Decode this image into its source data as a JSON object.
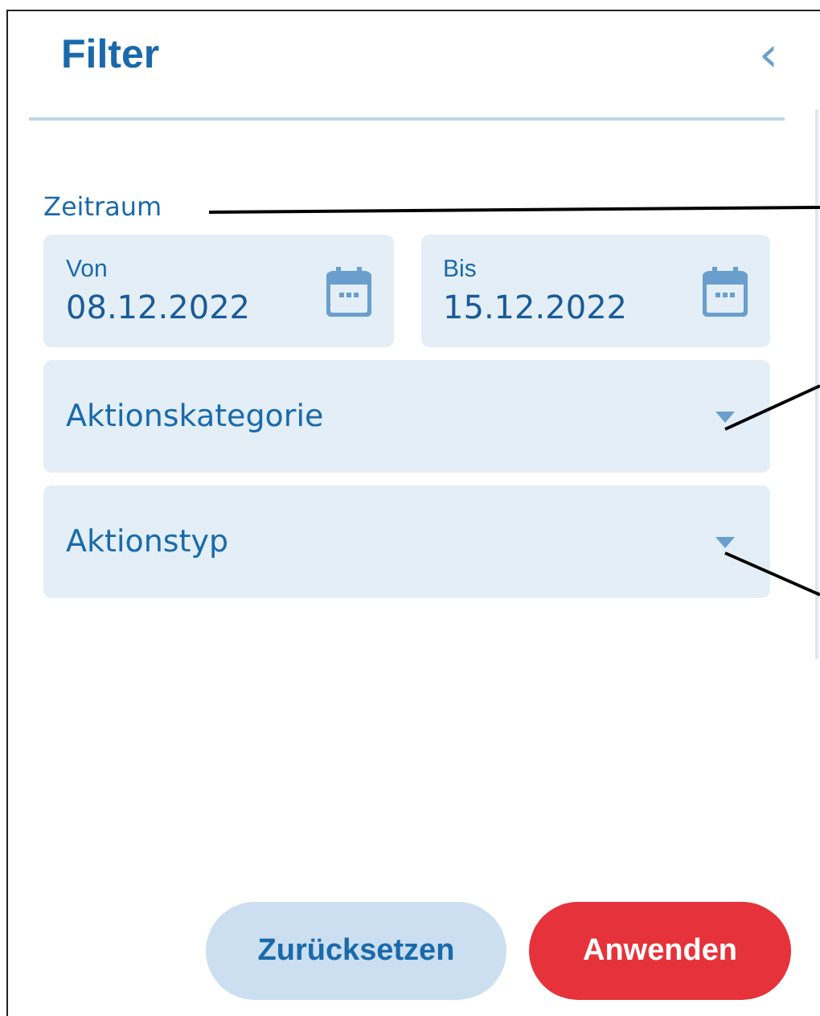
{
  "header": {
    "title": "Filter",
    "back_glyph": "‹"
  },
  "period": {
    "label": "Zeitraum",
    "fields": [
      {
        "label": "Von",
        "value": "08.12.2022"
      },
      {
        "label": "Bis",
        "value": "15.12.2022"
      }
    ]
  },
  "dropdowns": [
    {
      "label": "Aktionskategorie"
    },
    {
      "label": "Aktionstyp"
    }
  ],
  "buttons": [
    {
      "label": "Zurücksetzen",
      "kind": "secondary"
    },
    {
      "label": "Anwenden",
      "kind": "primary"
    }
  ]
}
